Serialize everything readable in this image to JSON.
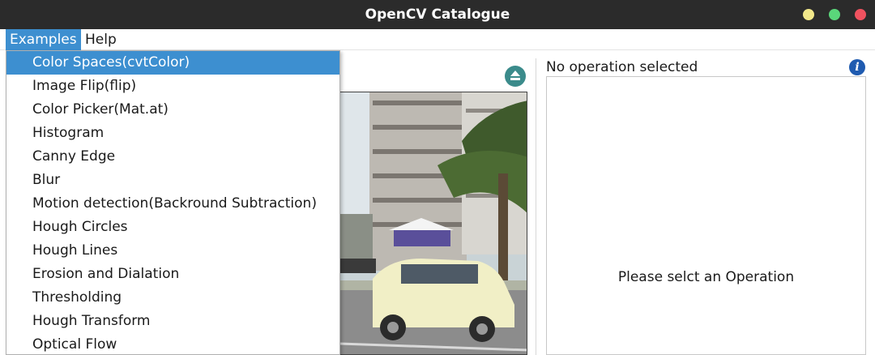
{
  "window": {
    "title": "OpenCV Catalogue"
  },
  "menubar": {
    "items": [
      "Examples",
      "Help"
    ]
  },
  "examples_menu": {
    "items": [
      "Color Spaces(cvtColor)",
      "Image Flip(flip)",
      "Color Picker(Mat.at)",
      "Histogram",
      "Canny Edge",
      "Blur",
      "Motion detection(Backround Subtraction)",
      "Hough Circles",
      "Hough Lines",
      "Erosion and Dialation",
      "Thresholding",
      "Hough Transform",
      "Optical Flow"
    ],
    "highlighted_index": 0
  },
  "right_panel": {
    "title": "No operation selected",
    "placeholder": "Please selct an Operation",
    "info_icon": "info-icon"
  },
  "left_panel": {
    "eject_icon": "eject-icon",
    "video_frame": "street scene with white car and palm tree"
  },
  "colors": {
    "accent": "#3d8fd0",
    "titlebar": "#2b2b2b",
    "eject": "#3b8b8b",
    "info": "#1f5bb0"
  }
}
